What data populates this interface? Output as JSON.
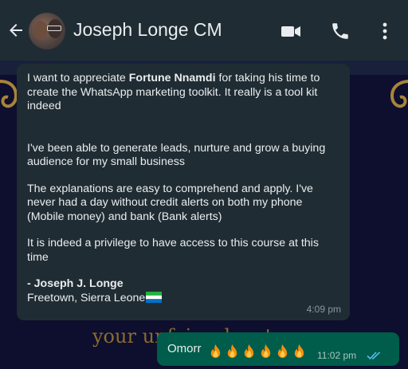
{
  "header": {
    "contact_name": "Joseph Longe CM",
    "icons": [
      "back-arrow-icon",
      "video-call-icon",
      "phone-icon",
      "more-vert-icon"
    ]
  },
  "background": {
    "text": "your unfair advantage"
  },
  "incoming": {
    "p1_before": "I want to appreciate ",
    "p1_bold": "Fortune Nnamdi",
    "p1_after": " for taking his time to create the WhatsApp marketing toolkit. It really is a tool kit indeed",
    "p2": "I've been able to generate leads, nurture and grow a buying audience for my small business",
    "p3": "The explanations are easy to comprehend and apply. I've never had a day without credit alerts on both my phone (Mobile money) and bank (Bank alerts)",
    "p4": "It is indeed a privilege to have access to this course at this time",
    "signature": "- Joseph J. Longe",
    "location": "Freetown, Sierra Leone",
    "flag": "sierra-leone-flag",
    "time": "4:09 pm"
  },
  "outgoing": {
    "text": "Omorr",
    "emoji": "fire-emoji",
    "emoji_count": 6,
    "time": "11:02 pm",
    "status_icon": "double-check-read-icon",
    "status_color": "#53bdeb"
  },
  "colors": {
    "header_bg": "#1f2c34",
    "incoming_bg": "#202c33",
    "outgoing_bg": "#005c4b",
    "wallpaper": "#0e0e2e",
    "gold": "#a8843a"
  }
}
